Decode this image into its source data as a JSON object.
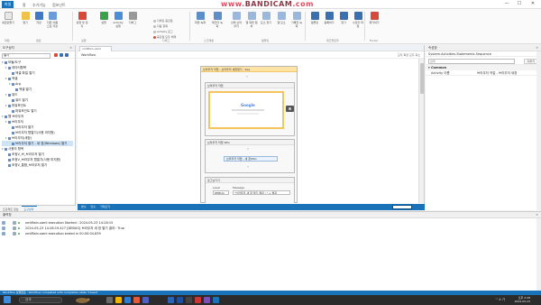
{
  "titlebar": {
    "tabs": [
      "파일",
      "홈",
      "추가기능",
      "컴포넌트"
    ],
    "watermark_a": "www.",
    "watermark_b": "BANDICAM",
    "watermark_c": ".com",
    "min": "—",
    "max": "☐",
    "close": "✕"
  },
  "ribbon": {
    "buttons": [
      "새로만들기",
      "열기",
      "저장",
      "다른 이름으로 저장",
      "실행 및 정지",
      "실행",
      "Activity 실행",
      "디버그"
    ],
    "small_items": [
      "디버깅 중단점",
      "다음 항목",
      "Activity 로그",
      "중단점 제거",
      "중단점 모두 해제"
    ],
    "right_buttons": [
      "화면 녹화",
      "레코더 녹화",
      "선택 브라우저",
      "웹 화면 캡처",
      "요소 찾기",
      "웹 요소",
      "기록한 녹화",
      "템플릿",
      "등록하기",
      "찾기",
      "수정할 파일",
      "파일 폴더",
      "제거하기"
    ],
    "groups": [
      "파일",
      "편집",
      "실행",
      "디버그",
      "스크래핑",
      "템플릿",
      "워크플로우",
      "Finder"
    ]
  },
  "left": {
    "title": "도구상자",
    "search_value": "열기",
    "tree": [
      {
        "label": "모듈/도구",
        "indent": 0,
        "arrow": "▾"
      },
      {
        "label": "데이터항목",
        "indent": 1,
        "arrow": "▾"
      },
      {
        "label": "엑셀 파일 열기",
        "indent": 2,
        "arrow": ""
      },
      {
        "label": "엑셀",
        "indent": 1,
        "arrow": "▾"
      },
      {
        "label": "Arp",
        "indent": 2,
        "arrow": "▾"
      },
      {
        "label": "엑셀 열기",
        "indent": 3,
        "arrow": ""
      },
      {
        "label": "워드",
        "indent": 1,
        "arrow": "▾"
      },
      {
        "label": "워드 열기",
        "indent": 2,
        "arrow": ""
      },
      {
        "label": "파워포인트",
        "indent": 1,
        "arrow": "▾"
      },
      {
        "label": "파워포인트 열기",
        "indent": 2,
        "arrow": ""
      },
      {
        "label": "웹 브라우저",
        "indent": 0,
        "arrow": "▾"
      },
      {
        "label": "브라우저",
        "indent": 1,
        "arrow": "▾"
      },
      {
        "label": "브라우저 열기",
        "indent": 2,
        "arrow": ""
      },
      {
        "label": "브라우저 탭열기(사용 미지원)",
        "indent": 2,
        "arrow": ""
      },
      {
        "label": "브라우저(새창)",
        "indent": 1,
        "arrow": "▾"
      },
      {
        "label": "브라우저 열기 - 새 창(Windows) 열기",
        "indent": 2,
        "arrow": "",
        "selected": true
      },
      {
        "label": "사용자 항목",
        "indent": 0,
        "arrow": "▾"
      },
      {
        "label": "조정V_브_브라우저 열기",
        "indent": 1,
        "arrow": ""
      },
      {
        "label": "조정V_브라우저 탭열기(사용 미지원)",
        "indent": 1,
        "arrow": ""
      },
      {
        "label": "조정V_통합_브라우저 열기",
        "indent": 1,
        "arrow": ""
      }
    ],
    "footer_tabs": [
      "프로젝트 정보",
      "도구상자"
    ]
  },
  "center": {
    "doc_tab": "xmlMain.xaml",
    "breadcrumb": "Workflow",
    "right_links": "모두 확장   모두 축소",
    "seq_title": "브라우저 작업 - 브라우저 새창열기 - Seq",
    "activity_title": "브라우저 작업",
    "google": "Google",
    "seq2_title": "브라우저 작업 SEQ",
    "open_pill": "브라우저 작업 - 새 창(Win",
    "log_title": "로그남기기",
    "level_label": "Level",
    "message_label": "Message",
    "level_value": "DEBUG",
    "message_value": "\"브라우저 새 창 열기 결과 : \" + 결과",
    "status_items": [
      "변수",
      "인수",
      "가져오기"
    ],
    "zoom_value": "100%"
  },
  "right": {
    "title": "속성창",
    "path": "System.Activities.Statements.Sequence",
    "search_placeholder": "검색",
    "clear_button": "지우기",
    "category": "Common",
    "props": [
      {
        "name": "Activity 이름",
        "value": "브라우저 작업 - 브라우저 새창"
      }
    ]
  },
  "output": {
    "title": "출력창",
    "lines": [
      "xmlMain.xaml execution Started : 2024-05-23 14:28:15",
      "2024-05-23 14:28:19.427 [DEBUG] 브라우저 새 창 열기 결과 : True",
      "xmlMain.xaml execution ended in 00:00:04.839"
    ]
  },
  "bottom_status": "Workflow 실행완료 : Workflow completed with completion state 'Closed'",
  "taskbar": {
    "search": "검색",
    "time": "오후 2:28",
    "date": "2024-05-23",
    "tray": "^  A  가"
  },
  "colors": {
    "accent": "#1a73b8",
    "highlight": "#ffe3a5",
    "watermark": "#e34b5f"
  }
}
